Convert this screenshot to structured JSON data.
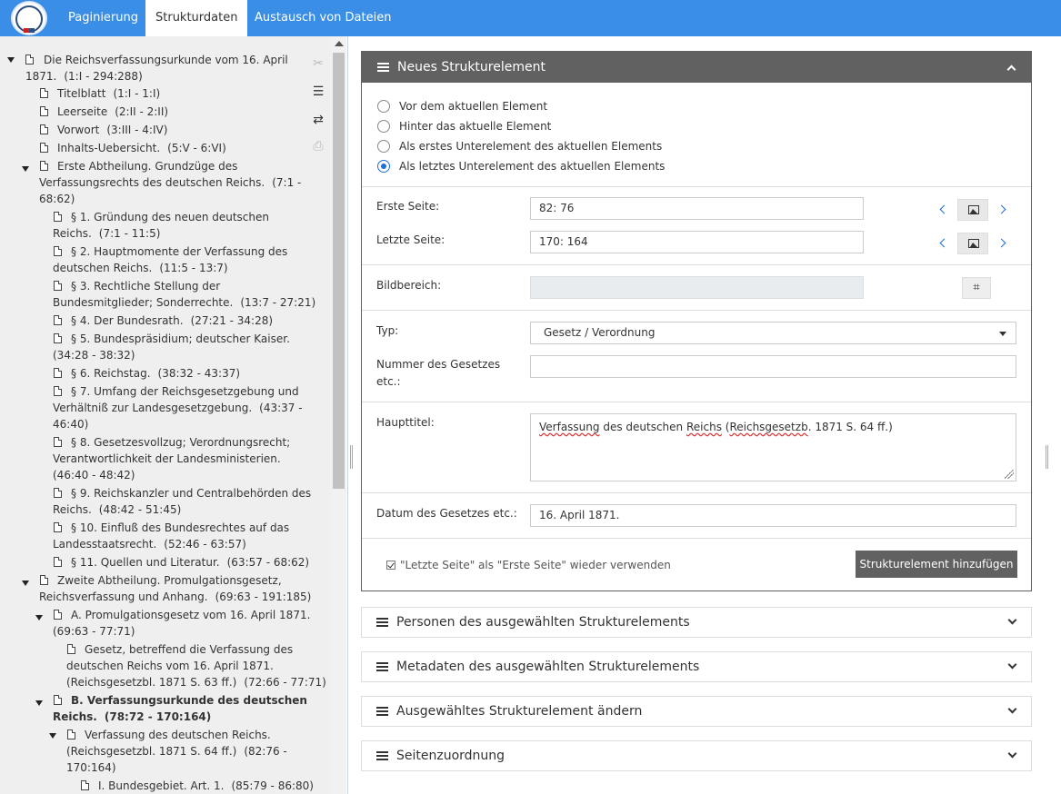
{
  "nav": {
    "tabs": [
      {
        "label": "Paginierung"
      },
      {
        "label": "Strukturdaten"
      },
      {
        "label": "Austausch von Dateien"
      }
    ]
  },
  "tree": {
    "nodes": [
      {
        "text": "Die Reichsverfassungsurkunde vom 16. April",
        "text2": "1871.",
        "pages": "(1:I - 294:288)"
      },
      {
        "text": "Titelblatt",
        "pages": "(1:I - 1:I)"
      },
      {
        "text": "Leerseite",
        "pages": "(2:II - 2:II)"
      },
      {
        "text": "Vorwort",
        "pages": "(3:III - 4:IV)"
      },
      {
        "text": "Inhalts-Uebersicht.",
        "pages": "(5:V - 6:VI)"
      },
      {
        "text": "Erste Abtheilung. Grundzüge des",
        "text2": "Verfassungsrechts des deutschen Reichs.",
        "pages": "(7:1 -",
        "pages2": "68:62)"
      },
      {
        "text": "§ 1. Gründung des neuen deutschen",
        "text2": "Reichs.",
        "pages": "(7:1 - 11:5)"
      },
      {
        "text": "§ 2. Hauptmomente der Verfassung des",
        "text2": "deutschen Reichs.",
        "pages": "(11:5 - 13:7)"
      },
      {
        "text": "§ 3. Rechtliche Stellung der",
        "text2": "Bundesmitglieder; Sonderrechte.",
        "pages": "(13:7 - 27:21)"
      },
      {
        "text": "§ 4. Der Bundesrath.",
        "pages": "(27:21 - 34:28)"
      },
      {
        "text": "§ 5. Bundespräsidium; deutscher Kaiser.",
        "pages": "(34:28 - 38:32)"
      },
      {
        "text": "§ 6. Reichstag.",
        "pages": "(38:32 - 43:37)"
      },
      {
        "text": "§ 7. Umfang der Reichsgesetzgebung und",
        "text2": "Verhältniß zur Landesgesetzgebung.",
        "pages": "(43:37 -",
        "pages2": "46:40)"
      },
      {
        "text": "§ 8. Gesetzesvollzug; Verordnungsrecht;",
        "text2": "Verantwortlichkeit der Landesministerien.",
        "pages": "(46:40 - 48:42)"
      },
      {
        "text": "§ 9. Reichskanzler und Centralbehörden des",
        "text2": "Reichs.",
        "pages": "(48:42 - 51:45)"
      },
      {
        "text": "§ 10. Einfluß des Bundesrechtes auf das",
        "text2": "Landesstaatsrecht.",
        "pages": "(52:46 - 63:57)"
      },
      {
        "text": "§ 11. Quellen und Literatur.",
        "pages": "(63:57 - 68:62)"
      },
      {
        "text": "Zweite Abtheilung. Promulgationsgesetz,",
        "text2": "Reichsverfassung und Anhang.",
        "pages": "(69:63 - 191:185)"
      },
      {
        "text": "A. Promulgationsgesetz vom 16. April 1871.",
        "pages": "(69:63 - 77:71)"
      },
      {
        "text": "Gesetz, betreffend die Verfassung des",
        "text2": "deutschen Reichs vom 16. April 1871.",
        "text3": "(Reichsgesetzbl. 1871 S. 63 ff.)",
        "pages": "(72:66 - 77:71)"
      },
      {
        "text": "B. Verfassungsurkunde des deutschen",
        "text2": "Reichs.",
        "pages": "(78:72 - 170:164)"
      },
      {
        "text": "Verfassung des deutschen Reichs.",
        "text2": "(Reichsgesetzbl. 1871 S. 64 ff.)",
        "pages": "(82:76 -",
        "pages2": "170:164)"
      },
      {
        "text": "I. Bundesgebiet. Art. 1.",
        "pages": "(85:79 - 86:80)"
      }
    ]
  },
  "panel": {
    "title": "Neues Strukturelement",
    "radios": [
      {
        "label": "Vor dem aktuellen Element",
        "checked": false
      },
      {
        "label": "Hinter das aktuelle Element",
        "checked": false
      },
      {
        "label": "Als erstes Unterelement des aktuellen Elements",
        "checked": false
      },
      {
        "label": "Als letztes Unterelement des aktuellen Elements",
        "checked": true
      }
    ],
    "first_page_label": "Erste Seite:",
    "first_page_value": "82: 76",
    "last_page_label": "Letzte Seite:",
    "last_page_value": "170: 164",
    "image_area_label": "Bildbereich:",
    "type_label": "Typ:",
    "type_value": "Gesetz / Verordnung",
    "number_label_1": "Nummer des Gesetzes",
    "number_label_2": "etc.:",
    "number_value": "",
    "main_title_label": "Haupttitel:",
    "main_title_part1": "Verfassung",
    "main_title_part2": " des deutschen ",
    "main_title_part3": "Reichs",
    "main_title_part4": " (",
    "main_title_part5": "Reichsgesetzb",
    "main_title_part6": ". 1871 S. 64 ff.)",
    "date_label": "Datum des Gesetzes etc.:",
    "date_value": "16. April 1871.",
    "reuse_label": "\"Letzte Seite\" als \"Erste Seite\" wieder verwenden",
    "add_button": "Strukturelement hinzufügen"
  },
  "sections": [
    {
      "label": "Personen des ausgewählten Strukturelements"
    },
    {
      "label": "Metadaten des ausgewählten Strukturelements"
    },
    {
      "label": "Ausgewähltes Strukturelement ändern"
    },
    {
      "label": "Seitenzuordnung"
    }
  ],
  "colors": {
    "nav_blue": "#3a8ee6",
    "panel_header": "#616161",
    "accent_blue": "#1f6fd6"
  }
}
